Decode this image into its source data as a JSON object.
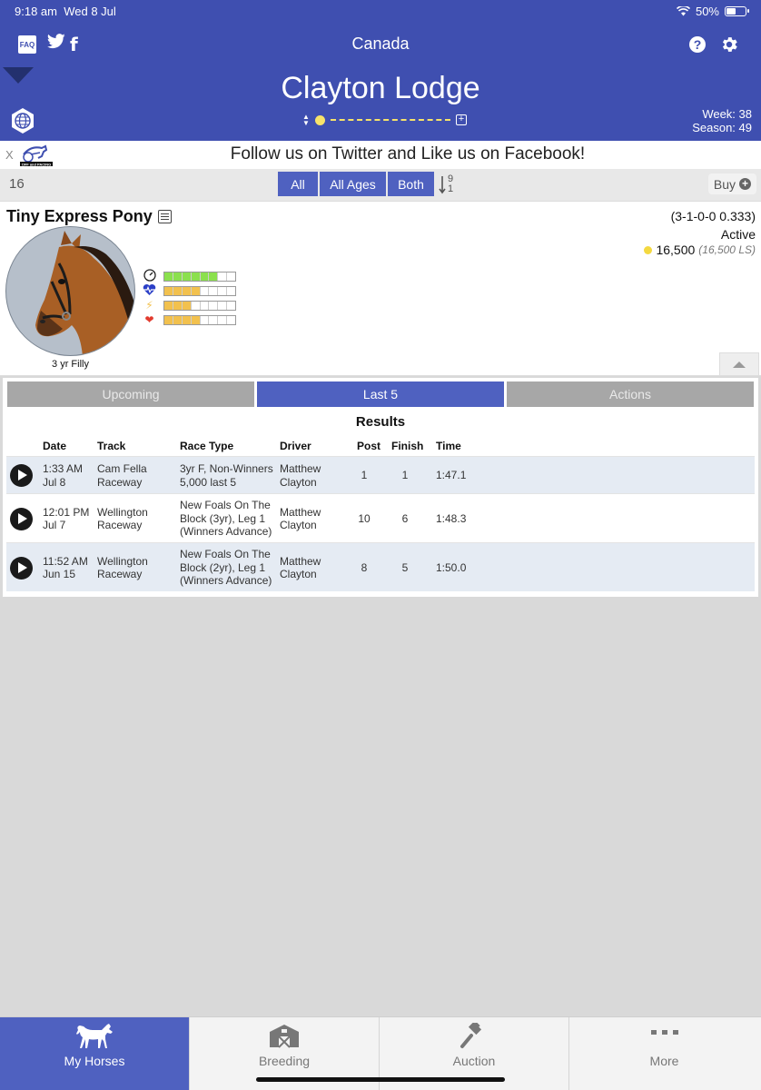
{
  "status_bar": {
    "time": "9:18 am",
    "date": "Wed 8 Jul",
    "battery": "50%",
    "battery_level": 0.5
  },
  "nav": {
    "faq": "FAQ",
    "title": "Canada",
    "icons": [
      "faq-icon",
      "twitter-icon",
      "facebook-icon",
      "help-icon",
      "gear-icon"
    ]
  },
  "stable": {
    "name": "Clayton Lodge",
    "week": "Week: 38",
    "season": "Season: 49"
  },
  "banner": {
    "close": "X",
    "text": "Follow us on Twitter and Like us on Facebook!",
    "logo_text": "OFF and PACING"
  },
  "filter": {
    "count": "16",
    "buttons": [
      "All",
      "All Ages",
      "Both"
    ],
    "sort_top": "9",
    "sort_bottom": "1",
    "buy": "Buy"
  },
  "horse": {
    "name": "Tiny Express Pony",
    "age_sex": "3 yr Filly",
    "record": "(3-1-0-0 0.333)",
    "status": "Active",
    "earnings": "16,500",
    "earnings_ls": "(16,500 LS)",
    "stats": [
      {
        "icon": "speed-icon",
        "color": "#8be04e",
        "level": 0.8
      },
      {
        "icon": "stamina-icon",
        "color": "#f2c14e",
        "level": 0.5
      },
      {
        "icon": "energy-icon",
        "color": "#f2c14e",
        "level": 0.4
      },
      {
        "icon": "health-icon",
        "color": "#f2c14e",
        "level": 0.45
      }
    ]
  },
  "tabs": [
    "Upcoming",
    "Last 5",
    "Actions"
  ],
  "results": {
    "title": "Results",
    "columns": [
      "Date",
      "Track",
      "Race Type",
      "Driver",
      "Post",
      "Finish",
      "Time"
    ],
    "rows": [
      {
        "date": [
          "1:33 AM",
          "Jul 8"
        ],
        "track": [
          "Cam Fella",
          "Raceway"
        ],
        "race": [
          "3yr F, Non-Winners",
          "5,000 last 5"
        ],
        "driver": [
          "Matthew",
          "Clayton"
        ],
        "post": "1",
        "finish": "1",
        "time": "1:47.1"
      },
      {
        "date": [
          "12:01 PM",
          "Jul 7"
        ],
        "track": [
          "Wellington",
          "Raceway"
        ],
        "race": [
          "New Foals On The",
          "Block (3yr), Leg 1",
          "(Winners Advance)"
        ],
        "driver": [
          "Matthew",
          "Clayton"
        ],
        "post": "10",
        "finish": "6",
        "time": "1:48.3"
      },
      {
        "date": [
          "11:52 AM",
          "Jun 15"
        ],
        "track": [
          "Wellington",
          "Raceway"
        ],
        "race": [
          "New Foals On The",
          "Block (2yr), Leg 1",
          "(Winners Advance)"
        ],
        "driver": [
          "Matthew",
          "Clayton"
        ],
        "post": "8",
        "finish": "5",
        "time": "1:50.0"
      }
    ]
  },
  "bottom_tabs": [
    {
      "label": "My Horses",
      "icon": "horse-icon"
    },
    {
      "label": "Breeding",
      "icon": "barn-icon"
    },
    {
      "label": "Auction",
      "icon": "gavel-icon"
    },
    {
      "label": "More",
      "icon": "more-icon"
    }
  ],
  "colors": {
    "primary": "#3f4fb0",
    "button": "#4f61c0",
    "row_alt": "#e5ebf3"
  }
}
